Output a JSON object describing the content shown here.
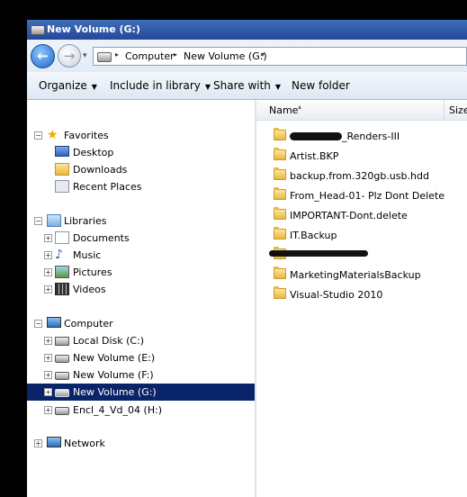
{
  "window": {
    "title": "New Volume (G:)"
  },
  "navigation": {
    "back_label": "Back",
    "forward_label": "Forward"
  },
  "address": {
    "crumbs": [
      "Computer",
      "New Volume (G:)"
    ]
  },
  "toolbar": {
    "organize": "Organize",
    "include_in_library": "Include in library",
    "share_with": "Share with",
    "new_folder": "New folder"
  },
  "nav_tree": {
    "favorites": {
      "label": "Favorites",
      "items": [
        "Desktop",
        "Downloads",
        "Recent Places"
      ]
    },
    "libraries": {
      "label": "Libraries",
      "items": [
        "Documents",
        "Music",
        "Pictures",
        "Videos"
      ]
    },
    "computer": {
      "label": "Computer",
      "items": [
        "Local Disk (C:)",
        "New Volume (E:)",
        "New Volume (F:)",
        "New Volume (G:)",
        "Encl_4_Vd_04 (H:)"
      ],
      "selected": "New Volume (G:)"
    },
    "network": {
      "label": "Network"
    }
  },
  "file_list": {
    "columns": {
      "name": "Name",
      "size": "Size"
    },
    "items": [
      "_Renders-III",
      "Artist.BKP",
      "backup.from.320gb.usb.hdd",
      "From_Head-01- Plz Dont Delete",
      "IMPORTANT-Dont.delete",
      "IT.Backup",
      "",
      "MarketingMaterialsBackup",
      "Visual-Studio 2010"
    ]
  }
}
